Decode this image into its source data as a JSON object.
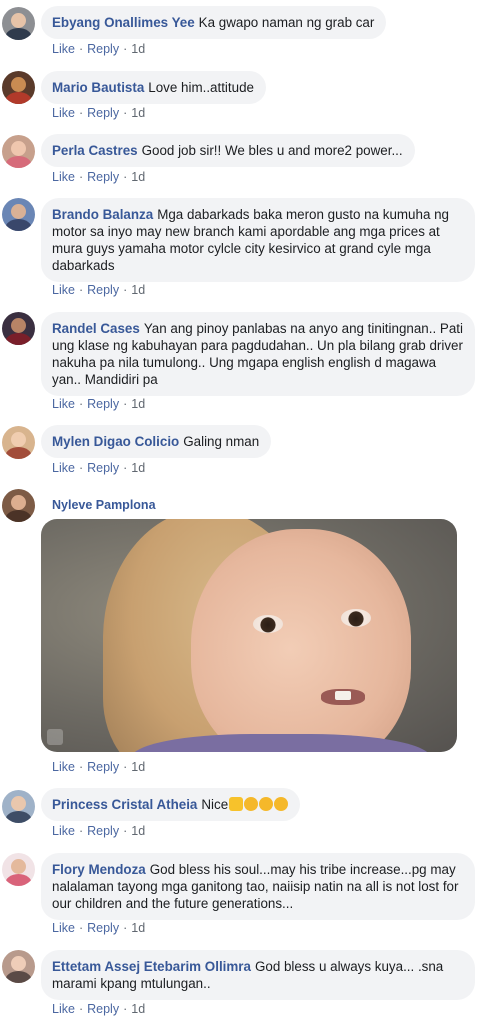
{
  "actions": {
    "like": "Like",
    "reply": "Reply",
    "dot": "·"
  },
  "comments": [
    {
      "author": "Ebyang Onallimes Yee",
      "text": "Ka gwapo naman ng grab car",
      "time": "1d"
    },
    {
      "author": "Mario Bautista",
      "text": "Love him..attitude",
      "time": "1d"
    },
    {
      "author": "Perla Castres",
      "text": "Good job sir!! We bles u and more2 power...",
      "time": "1d"
    },
    {
      "author": "Brando Balanza",
      "text": "Mga dabarkads baka meron gusto na kumuha ng motor sa inyo may new branch kami apordable ang mga prices at mura guys yamaha motor cylcle city kesirvico at grand cyle mga dabarkads",
      "time": "1d"
    },
    {
      "author": "Randel Cases",
      "text": "Yan ang pinoy panlabas na anyo ang tinitingnan.. Pati ung klase ng kabuhayan para pagdudahan.. Un pla bilang grab driver nakuha pa nila tumulong.. Ung mgapa english english d magawa yan.. Mandidiri pa",
      "time": "1d"
    },
    {
      "author": "Mylen Digao Colicio",
      "text": "Galing nman",
      "time": "1d"
    },
    {
      "author": "Nyleve Pamplona",
      "text": "",
      "time": "1d"
    },
    {
      "author": "Princess Cristal Atheia",
      "text": "Nice",
      "time": "1d"
    },
    {
      "author": "Flory Mendoza",
      "text": "God bless his soul...may his tribe increase...pg may nalalaman tayong mga ganitong tao, naiisip natin na all is not lost for our children and the future generations...",
      "time": "1d"
    },
    {
      "author": "Ettetam Assej Etebarim Ollimra",
      "text": "God bless u always kuya... .sna marami kpang mtulungan..",
      "time": "1d"
    }
  ],
  "colors": {
    "author_link": "#385898",
    "bubble_bg": "#f2f3f5",
    "meta_link": "#4b67a1",
    "meta_text": "#606770",
    "emoji_yellow": "#f7c22b"
  },
  "icons": [
    "avatar",
    "thumbs-up-emoji",
    "clapping-hands-emoji",
    "gif-reaction-image"
  ]
}
